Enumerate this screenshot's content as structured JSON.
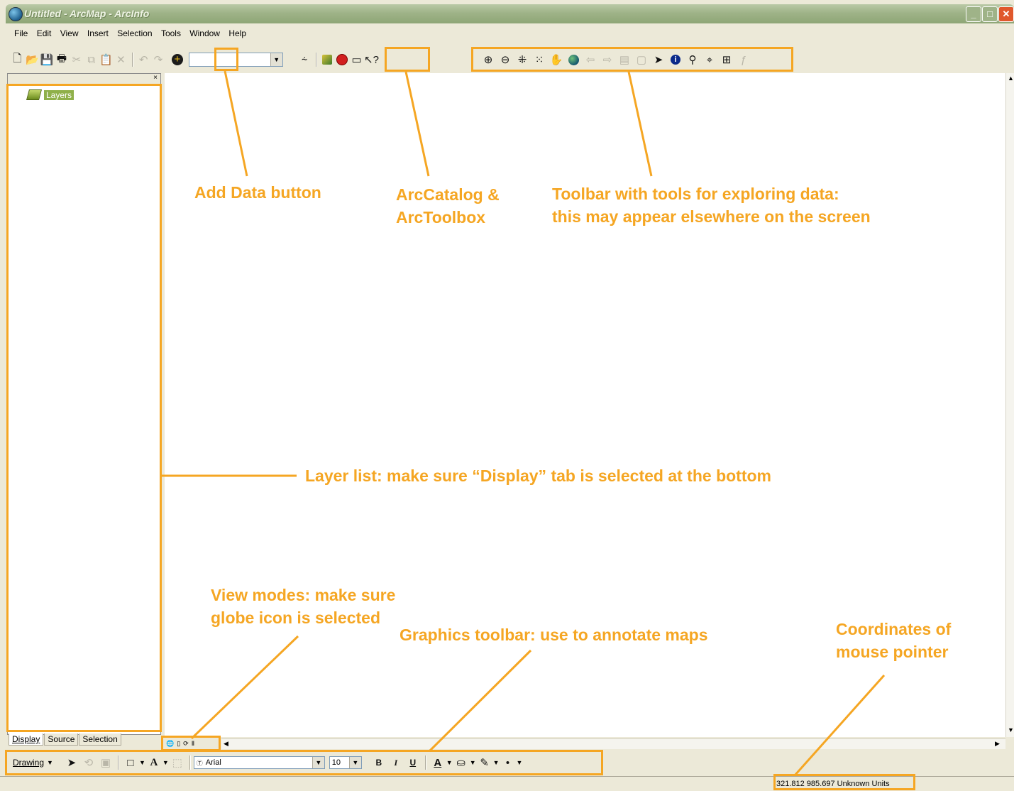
{
  "window": {
    "title": "Untitled - ArcMap - ArcInfo",
    "controls": [
      "_",
      "□",
      "✕"
    ]
  },
  "menubar": {
    "items": [
      "File",
      "Edit",
      "View",
      "Insert",
      "Selection",
      "Tools",
      "Window",
      "Help"
    ]
  },
  "toc": {
    "root_layer": "Layers",
    "tabs": [
      "Display",
      "Source",
      "Selection"
    ],
    "active_tab": "Display"
  },
  "drawing_toolbar": {
    "menu_label": "Drawing",
    "font_name": "Arial",
    "font_size": "10",
    "bold": "B",
    "italic": "I",
    "underline": "U"
  },
  "status_bar": {
    "coordinates": "321.812  985.697 Unknown Units"
  },
  "annotations": {
    "add_data": "Add Data button",
    "arccatalog": [
      "ArcCatalog &",
      "ArcToolbox"
    ],
    "explore_toolbar": [
      "Toolbar with tools for exploring data:",
      "this may appear elsewhere on the screen"
    ],
    "layer_list": "Layer list: make sure “Display” tab is selected at the bottom",
    "view_modes": [
      "View modes: make sure",
      "globe icon is selected"
    ],
    "graphics_toolbar": "Graphics toolbar: use to annotate maps",
    "coordinates": [
      "Coordinates of",
      "mouse pointer"
    ]
  },
  "accent_color": "#f5a623"
}
